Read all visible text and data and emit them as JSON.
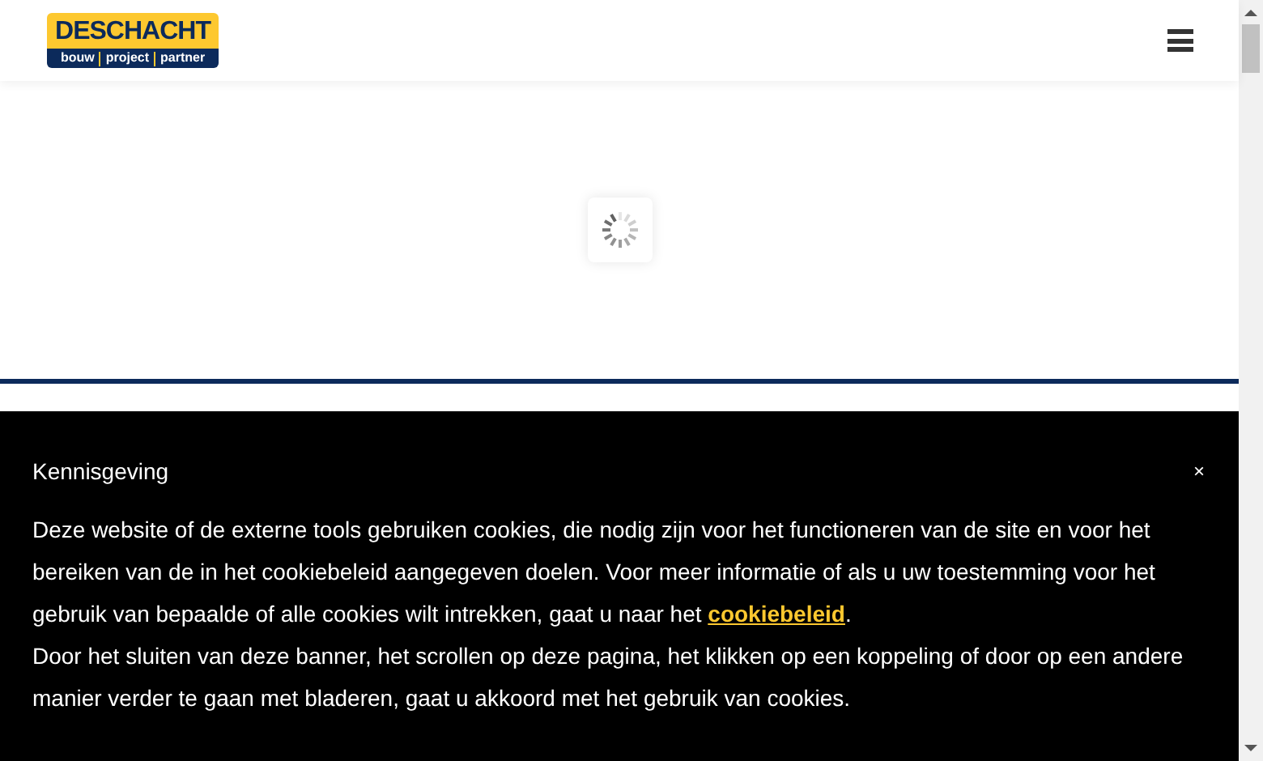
{
  "header": {
    "logo": {
      "name": "DESCHACHT",
      "tagline": [
        "bouw",
        "project",
        "partner"
      ]
    }
  },
  "cookie_banner": {
    "title": "Kennisgeving",
    "close": "×",
    "paragraphs": [
      {
        "before": "Deze website of de externe tools gebruiken cookies, die nodig zijn voor het functioneren van de site en voor het bereiken van de in het cookiebeleid aangegeven doelen. Voor meer informatie of als u uw toestemming voor het gebruik van bepaalde of alle cookies wilt intrekken, gaat u naar het ",
        "link": "cookiebeleid",
        "after": "."
      },
      {
        "before": "Door het sluiten van deze banner, het scrollen op deze pagina, het klikken op een koppeling of door op een andere manier verder te gaan met bladeren, gaat u akkoord met het gebruik van cookies."
      }
    ]
  }
}
